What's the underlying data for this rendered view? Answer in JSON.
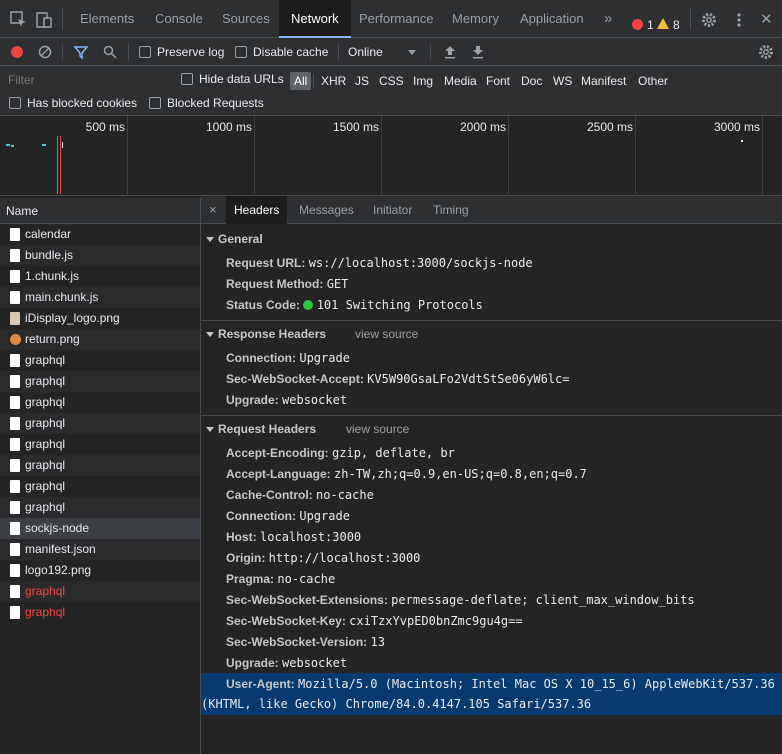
{
  "devtools": {
    "tabs": [
      {
        "label": "Elements"
      },
      {
        "label": "Console"
      },
      {
        "label": "Sources"
      },
      {
        "label": "Network"
      },
      {
        "label": "Performance"
      },
      {
        "label": "Memory"
      },
      {
        "label": "Application"
      }
    ],
    "more_tabs": "»",
    "error_count": "1",
    "warning_count": "8",
    "colors": {
      "accent": "#8ab4f8",
      "record": "#ee4444",
      "error": "#ee4444",
      "selection": "#073b6f",
      "status_ok": "#2fc545"
    }
  },
  "toolbar": {
    "preserve_log": "Preserve log",
    "disable_cache": "Disable cache",
    "throttle": "Online"
  },
  "filter": {
    "placeholder": "Filter",
    "hide_data_urls": "Hide data URLs",
    "types": [
      "All",
      "XHR",
      "JS",
      "CSS",
      "Img",
      "Media",
      "Font",
      "Doc",
      "WS",
      "Manifest",
      "Other"
    ],
    "has_blocked_cookies": "Has blocked cookies",
    "blocked_requests": "Blocked Requests"
  },
  "overview": {
    "ticks": [
      "500 ms",
      "1000 ms",
      "1500 ms",
      "2000 ms",
      "2500 ms",
      "3000 ms"
    ]
  },
  "requests": {
    "header": "Name",
    "items": [
      {
        "name": "calendar",
        "icon": "document-icon"
      },
      {
        "name": "bundle.js",
        "icon": "document-icon"
      },
      {
        "name": "1.chunk.js",
        "icon": "document-icon"
      },
      {
        "name": "main.chunk.js",
        "icon": "document-icon"
      },
      {
        "name": "iDisplay_logo.png",
        "icon": "image-icon"
      },
      {
        "name": "return.png",
        "icon": "image-icon"
      },
      {
        "name": "graphql",
        "icon": "document-icon"
      },
      {
        "name": "graphql",
        "icon": "document-icon"
      },
      {
        "name": "graphql",
        "icon": "document-icon"
      },
      {
        "name": "graphql",
        "icon": "document-icon"
      },
      {
        "name": "graphql",
        "icon": "document-icon"
      },
      {
        "name": "graphql",
        "icon": "document-icon"
      },
      {
        "name": "graphql",
        "icon": "document-icon"
      },
      {
        "name": "graphql",
        "icon": "document-icon"
      },
      {
        "name": "sockjs-node",
        "icon": "document-icon"
      },
      {
        "name": "manifest.json",
        "icon": "document-icon"
      },
      {
        "name": "logo192.png",
        "icon": "document-icon"
      },
      {
        "name": "graphql",
        "icon": "document-icon"
      },
      {
        "name": "graphql",
        "icon": "document-icon"
      }
    ]
  },
  "details": {
    "close": "×",
    "tabs": [
      "Headers",
      "Messages",
      "Initiator",
      "Timing"
    ],
    "view_source": "view source",
    "general": {
      "title": "General",
      "rows": [
        {
          "k": "Request URL:",
          "v": "ws://localhost:3000/sockjs-node"
        },
        {
          "k": "Request Method:",
          "v": "GET"
        },
        {
          "k": "Status Code:",
          "v": "101 Switching Protocols"
        }
      ]
    },
    "response": {
      "title": "Response Headers",
      "rows": [
        {
          "k": "Connection:",
          "v": "Upgrade"
        },
        {
          "k": "Sec-WebSocket-Accept:",
          "v": "KV5W90GsaLFo2VdtStSe06yW6lc="
        },
        {
          "k": "Upgrade:",
          "v": "websocket"
        }
      ]
    },
    "request": {
      "title": "Request Headers",
      "rows": [
        {
          "k": "Accept-Encoding:",
          "v": "gzip, deflate, br"
        },
        {
          "k": "Accept-Language:",
          "v": "zh-TW,zh;q=0.9,en-US;q=0.8,en;q=0.7"
        },
        {
          "k": "Cache-Control:",
          "v": "no-cache"
        },
        {
          "k": "Connection:",
          "v": "Upgrade"
        },
        {
          "k": "Host:",
          "v": "localhost:3000"
        },
        {
          "k": "Origin:",
          "v": "http://localhost:3000"
        },
        {
          "k": "Pragma:",
          "v": "no-cache"
        },
        {
          "k": "Sec-WebSocket-Extensions:",
          "v": "permessage-deflate; client_max_window_bits"
        },
        {
          "k": "Sec-WebSocket-Key:",
          "v": "cxiTzxYvpED0bnZmc9gu4g=="
        },
        {
          "k": "Sec-WebSocket-Version:",
          "v": "13"
        },
        {
          "k": "Upgrade:",
          "v": "websocket"
        }
      ],
      "user_agent_key": "User-Agent:",
      "user_agent_line1": "Mozilla/5.0 (Macintosh; Intel Mac OS X 10_15_6) AppleWebKit/537.36",
      "user_agent_line2": "(KHTML, like Gecko) Chrome/84.0.4147.105 Safari/537.36"
    }
  }
}
